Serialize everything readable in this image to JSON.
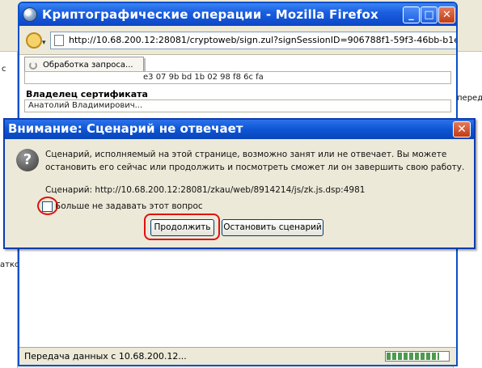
{
  "outer": {
    "left_fragments": [
      "с",
      "атко"
    ],
    "right_fragment": "перед"
  },
  "popup": {
    "title": "Криптографические операции - Mozilla Firefox",
    "buttons": {
      "minimize": "_",
      "maximize": "□",
      "close": "✕"
    },
    "url": "http://10.68.200.12:28081/cryptoweb/sign.zul?signSessionID=906788f1-59f3-46bb-b1e",
    "loading_text": "Обработка запроса...",
    "hash_field": "e3 07 9b bd 1b 02 98 f8 6c fa",
    "owner_label": "Владелец сертификата",
    "owner_value": "Анатолий Владимирович...",
    "status_text": "Передача данных с 10.68.200.12...",
    "progress": 0.85
  },
  "dialog": {
    "title": "Внимание: Сценарий не отвечает",
    "close_glyph": "✕",
    "icon_glyph": "?",
    "message_line1": "Сценарий, исполняемый на этой странице, возможно занят или не отвечает. Вы можете",
    "message_line2": "остановить его сейчас или продолжить и посмотреть сможет ли он завершить свою работу.",
    "script_line": "Сценарий: http://10.68.200.12:28081/zkau/web/8914214/js/zk.js.dsp:4981",
    "checkbox_label": "Больше не задавать этот вопрос",
    "checkbox_checked": false,
    "continue_label": "Продолжить",
    "stop_label": "Остановить сценарий"
  }
}
